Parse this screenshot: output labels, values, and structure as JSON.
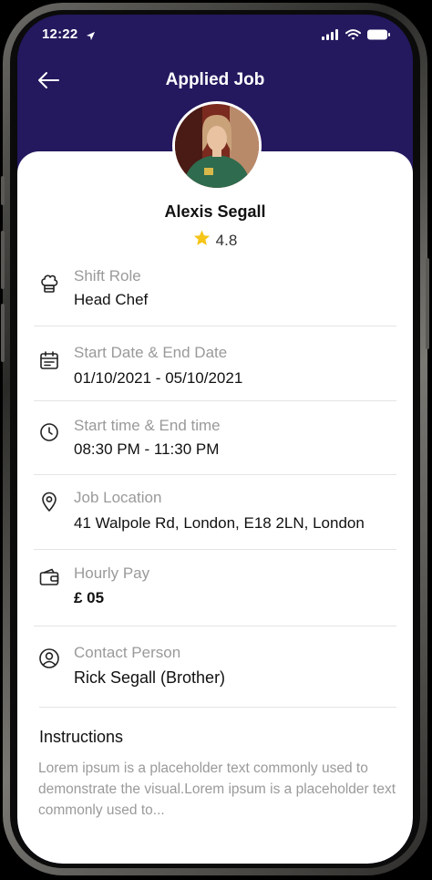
{
  "status_bar": {
    "time": "12:22"
  },
  "header": {
    "title": "Applied Job"
  },
  "profile": {
    "name": "Alexis Segall",
    "rating": "4.8"
  },
  "details": [
    {
      "label": "Shift Role",
      "value": "Head Chef",
      "icon": "chef-hat-icon"
    },
    {
      "label": "Start Date & End Date",
      "value": "01/10/2021 - 05/10/2021",
      "icon": "calendar-icon"
    },
    {
      "label": "Start time & End time",
      "value": "08:30 PM - 11:30 PM",
      "icon": "clock-icon"
    },
    {
      "label": "Job Location",
      "value": "41 Walpole Rd, London, E18 2LN, London",
      "icon": "location-pin-icon"
    },
    {
      "label": "Hourly Pay",
      "value": "£ 05",
      "icon": "wallet-icon"
    },
    {
      "label": "Contact Person",
      "value": "Rick Segall (Brother)",
      "icon": "user-circle-icon"
    }
  ],
  "instructions": {
    "title": "Instructions",
    "text": "Lorem ipsum is a placeholder text commonly used to demonstrate the visual.Lorem ipsum is a placeholder text commonly used to..."
  },
  "colors": {
    "header_bg": "#24185e",
    "star": "#f5c518"
  }
}
